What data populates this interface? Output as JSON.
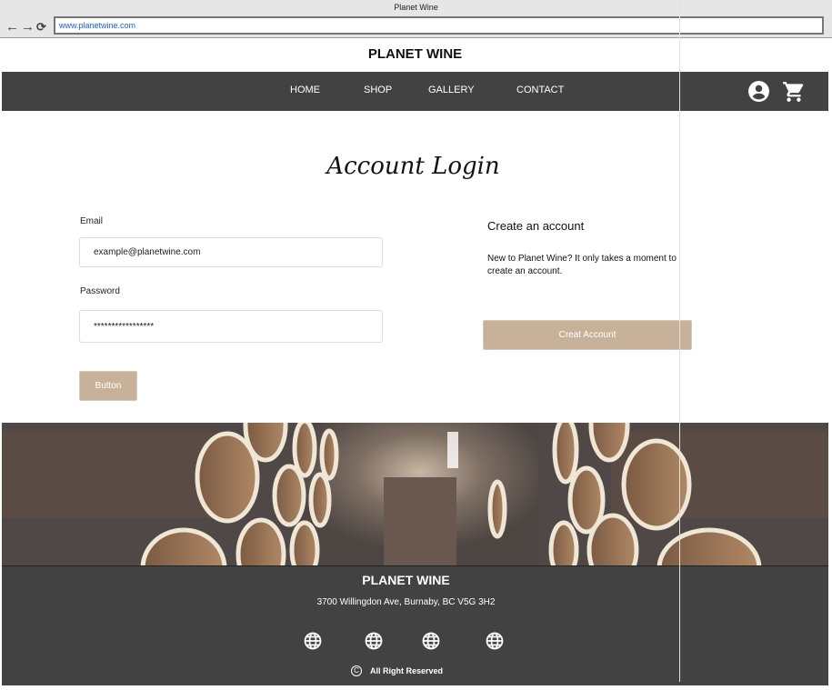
{
  "browser": {
    "window_title": "Planet Wine",
    "url": "www.planetwine.com"
  },
  "header": {
    "brand": "PLANET WINE"
  },
  "nav": {
    "items": [
      {
        "label": "HOME"
      },
      {
        "label": "SHOP"
      },
      {
        "label": "GALLERY"
      },
      {
        "label": "CONTACT"
      }
    ],
    "icons": [
      "account-circle-icon",
      "shopping-cart-icon"
    ]
  },
  "login": {
    "title": "Account Login",
    "email_label": "Email",
    "email_value": "example@planetwine.com",
    "password_label": "Password",
    "password_value": "*****************",
    "submit_label": "Button"
  },
  "create": {
    "heading": "Create an account",
    "text": "New to Planet Wine? It only takes a moment to create an account.",
    "button_label": "Creat Account"
  },
  "footer": {
    "brand": "PLANET WINE",
    "address": "3700 Willingdon Ave, Burnaby, BC V5G 3H2",
    "social_icons": [
      "globe-icon",
      "globe-icon",
      "globe-icon",
      "globe-icon"
    ],
    "copyright": "All Right Reserved",
    "copyright_symbol": "C"
  },
  "colors": {
    "nav_bg": "#424242",
    "accent_button": "#c8b199",
    "link": "#1a5fd0"
  }
}
